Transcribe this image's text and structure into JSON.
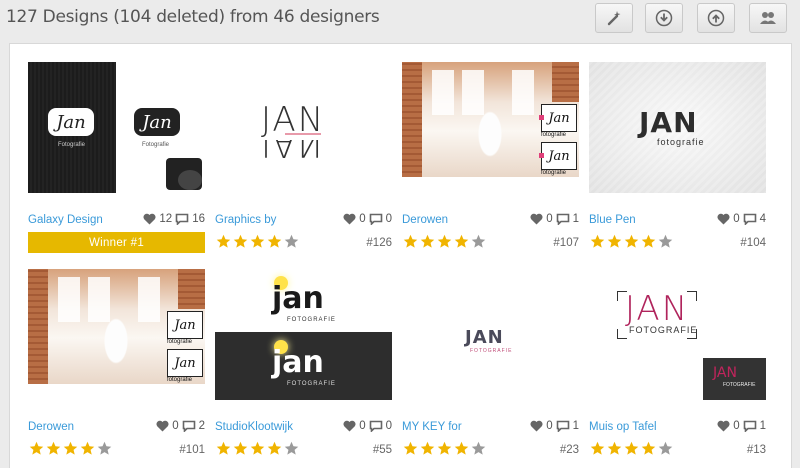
{
  "header": {
    "title": "127 Designs (104 deleted) from 46 designers",
    "buttons": [
      {
        "name": "magic-wand-icon"
      },
      {
        "name": "download-icon"
      },
      {
        "name": "upload-icon"
      },
      {
        "name": "users-icon"
      }
    ]
  },
  "colors": {
    "accent_link": "#3a9ad9",
    "winner_bg": "#e6b800",
    "star_gold": "#f0b400",
    "star_grey": "#9a9a9a"
  },
  "designs": [
    {
      "name": "Galaxy Design",
      "likes": "12",
      "comments": "16",
      "winner": "Winner #1",
      "number": "",
      "stars": 0,
      "thumb_text": [
        "Jan",
        "Fotografie",
        "Jan",
        "Fotografie"
      ]
    },
    {
      "name": "Graphics by",
      "likes": "0",
      "comments": "0",
      "winner": "",
      "number": "#126",
      "stars": 4,
      "thumb_text": [
        "JAN",
        "JAN"
      ]
    },
    {
      "name": "Derowen",
      "likes": "0",
      "comments": "1",
      "winner": "",
      "number": "#107",
      "stars": 4,
      "thumb_text": [
        "Jan",
        "fotografie",
        "Jan",
        "fotografie"
      ]
    },
    {
      "name": "Blue Pen",
      "likes": "0",
      "comments": "4",
      "winner": "",
      "number": "#104",
      "stars": 4,
      "thumb_text": [
        "JAN",
        "fotografie"
      ]
    },
    {
      "name": "Derowen",
      "likes": "0",
      "comments": "2",
      "winner": "",
      "number": "#101",
      "stars": 4,
      "thumb_text": [
        "Jan",
        "fotografie",
        "Jan",
        "fotografie"
      ]
    },
    {
      "name": "StudioKlootwijk",
      "likes": "0",
      "comments": "0",
      "winner": "",
      "number": "#55",
      "stars": 4,
      "thumb_text": [
        "jan",
        "FOTOGRAFIE",
        "jan",
        "FOTOGRAFIE"
      ]
    },
    {
      "name": "MY KEY for",
      "likes": "0",
      "comments": "1",
      "winner": "",
      "number": "#23",
      "stars": 4,
      "thumb_text": [
        "JAN",
        "FOTOGRAFIE"
      ]
    },
    {
      "name": "Muis op Tafel",
      "likes": "0",
      "comments": "1",
      "winner": "",
      "number": "#13",
      "stars": 4,
      "thumb_text": [
        "JAN",
        "FOTOGRAFIE",
        "JAN",
        "FOTOGRAFIE"
      ]
    }
  ]
}
